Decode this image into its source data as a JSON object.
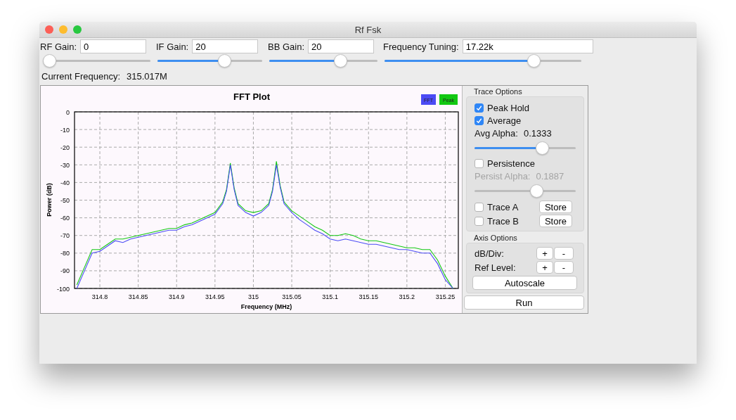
{
  "window": {
    "title": "Rf Fsk"
  },
  "gains": [
    {
      "label": "RF Gain:",
      "value": "0",
      "level": 0
    },
    {
      "label": "IF Gain:",
      "value": "20",
      "level": 0.66
    },
    {
      "label": "BB Gain:",
      "value": "20",
      "level": 0.68
    },
    {
      "label": "Frequency Tuning:",
      "value": "17.22k",
      "level": 0.775
    }
  ],
  "current_frequency": {
    "label": "Current Frequency:",
    "value": "315.017M"
  },
  "plot": {
    "chart_data": {
      "type": "line",
      "grid": true,
      "title": "FFT Plot",
      "xlabel": "Frequency (MHz)",
      "ylabel": "Power (dB)",
      "xlim": [
        314.767,
        315.267
      ],
      "ylim": [
        -100,
        0
      ],
      "xticks": [
        314.8,
        314.85,
        314.9,
        314.95,
        315,
        315.05,
        315.1,
        315.15,
        315.2,
        315.25
      ],
      "yticks": [
        0,
        -10,
        -20,
        -30,
        -40,
        -50,
        -60,
        -70,
        -80,
        -90,
        -100
      ],
      "x": [
        314.77,
        314.78,
        314.79,
        314.8,
        314.81,
        314.82,
        314.83,
        314.84,
        314.85,
        314.86,
        314.87,
        314.88,
        314.89,
        314.9,
        314.91,
        314.92,
        314.93,
        314.94,
        314.95,
        314.96,
        314.965,
        314.97,
        314.975,
        314.98,
        314.99,
        315,
        315.01,
        315.02,
        315.025,
        315.03,
        315.035,
        315.04,
        315.05,
        315.06,
        315.07,
        315.08,
        315.09,
        315.1,
        315.11,
        315.12,
        315.13,
        315.14,
        315.15,
        315.16,
        315.17,
        315.18,
        315.19,
        315.2,
        315.21,
        315.22,
        315.23,
        315.24,
        315.25,
        315.26
      ],
      "series": [
        {
          "name": "FFT",
          "color": "#4b4bf5",
          "values": [
            -100,
            -90,
            -80,
            -79,
            -76,
            -73,
            -74,
            -72,
            -71,
            -70,
            -69,
            -68,
            -67,
            -67,
            -65,
            -64,
            -62,
            -60,
            -58,
            -52,
            -45,
            -30,
            -44,
            -53,
            -57,
            -59,
            -57,
            -53,
            -45,
            -30,
            -43,
            -52,
            -57,
            -61,
            -64,
            -67,
            -69,
            -72,
            -73,
            -72,
            -73,
            -74,
            -75,
            -75,
            -76,
            -77,
            -78,
            -78,
            -79,
            -80,
            -80,
            -86,
            -95,
            -100
          ]
        },
        {
          "name": "Peak",
          "color": "#12c812",
          "values": [
            -98,
            -88,
            -78,
            -78,
            -75,
            -72,
            -72,
            -71,
            -70,
            -69,
            -68,
            -67,
            -66,
            -66,
            -64,
            -63,
            -61,
            -59,
            -57,
            -51,
            -44,
            -29,
            -43,
            -52,
            -56,
            -57,
            -56,
            -52,
            -44,
            -28,
            -42,
            -51,
            -56,
            -59,
            -62,
            -65,
            -67,
            -70,
            -70,
            -69,
            -70,
            -72,
            -73,
            -73,
            -74,
            -75,
            -76,
            -77,
            -77,
            -78,
            -78,
            -84,
            -93,
            -100
          ]
        }
      ]
    }
  },
  "trace_options": {
    "title": "Trace Options",
    "peak_hold": {
      "label": "Peak Hold",
      "checked": true
    },
    "average": {
      "label": "Average",
      "checked": true
    },
    "avg_alpha": {
      "label": "Avg Alpha:",
      "value": "0.1333",
      "level": 0.69
    },
    "persistence": {
      "label": "Persistence",
      "checked": false
    },
    "persist_alpha": {
      "label": "Persist Alpha:",
      "value": "0.1887",
      "level": 0.63,
      "disabled": true
    },
    "traces": [
      {
        "label": "Trace A",
        "checked": false,
        "button": "Store"
      },
      {
        "label": "Trace B",
        "checked": false,
        "button": "Store"
      }
    ]
  },
  "axis_options": {
    "title": "Axis Options",
    "rows": [
      {
        "label": "dB/Div:",
        "plus": "+",
        "minus": "-"
      },
      {
        "label": "Ref Level:",
        "plus": "+",
        "minus": "-"
      }
    ],
    "autoscale": "Autoscale"
  },
  "run_button": "Run"
}
